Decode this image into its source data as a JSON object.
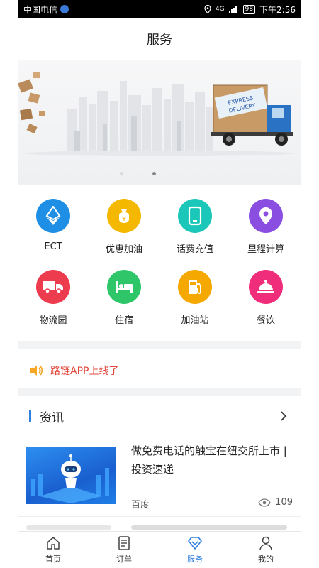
{
  "status_bar": {
    "carrier": "中国电信",
    "signal": "4G",
    "battery": "98",
    "time": "下午2:56"
  },
  "header": {
    "title": "服务"
  },
  "banner": {
    "sign_line1": "EXPRESS",
    "sign_line2": "DELIVERY",
    "active_slide": 1
  },
  "services": [
    {
      "label": "ECT",
      "icon": "ethereum-icon",
      "color": "#1f8fe6"
    },
    {
      "label": "优惠加油",
      "icon": "money-bag-icon",
      "color": "#f5b800"
    },
    {
      "label": "话费充值",
      "icon": "phone-icon",
      "color": "#1ac7b8"
    },
    {
      "label": "里程计算",
      "icon": "location-pin-icon",
      "color": "#8a4fe0"
    },
    {
      "label": "物流园",
      "icon": "truck-icon",
      "color": "#ee3c4f"
    },
    {
      "label": "住宿",
      "icon": "bed-icon",
      "color": "#2fc66a"
    },
    {
      "label": "加油站",
      "icon": "fuel-pump-icon",
      "color": "#f5a800"
    },
    {
      "label": "餐饮",
      "icon": "dish-cloche-icon",
      "color": "#ef2d7a"
    }
  ],
  "notice": {
    "text": "路链APP上线了",
    "icon": "speaker-icon"
  },
  "news": {
    "section_title": "资讯",
    "items": [
      {
        "headline": "做免费电话的触宝在纽交所上市 | 投资速递",
        "source": "百度",
        "views": "109"
      }
    ]
  },
  "tab_bar": {
    "tabs": [
      {
        "label": "首页",
        "icon": "home-icon",
        "active": false
      },
      {
        "label": "订单",
        "icon": "order-list-icon",
        "active": false
      },
      {
        "label": "服务",
        "icon": "service-diamond-icon",
        "active": true
      },
      {
        "label": "我的",
        "icon": "user-icon",
        "active": false
      }
    ]
  },
  "colors": {
    "accent": "#2f7fe0",
    "notice": "#e0473b"
  }
}
